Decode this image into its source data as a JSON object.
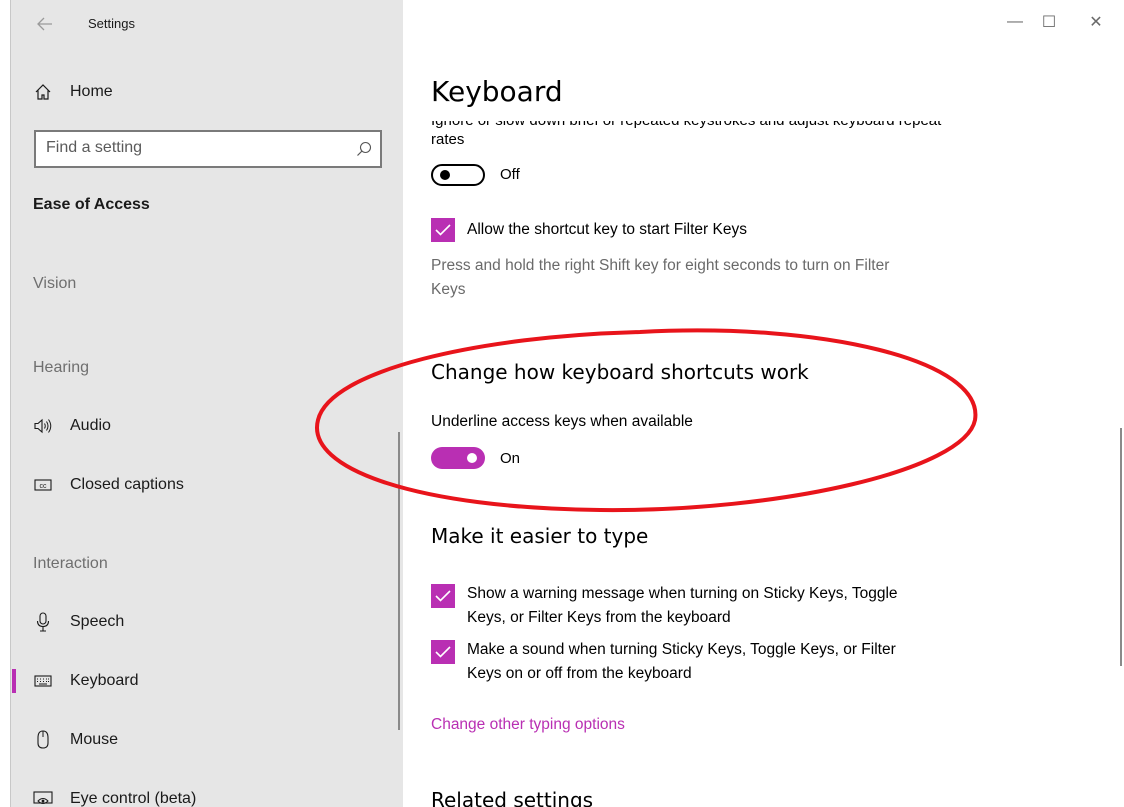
{
  "window": {
    "app_title": "Settings",
    "back_icon": "back-arrow-icon",
    "controls": {
      "minimize": "—",
      "maximize": "☐",
      "close": "✕"
    }
  },
  "sidebar": {
    "home_label": "Home",
    "search_placeholder": "Find a setting",
    "category": "Ease of Access",
    "sections": {
      "vision": "Vision",
      "hearing": "Hearing",
      "interaction": "Interaction"
    },
    "hearing_items": [
      {
        "label": "Audio",
        "icon": "speaker-icon"
      },
      {
        "label": "Closed captions",
        "icon": "cc-icon"
      }
    ],
    "interaction_items": [
      {
        "label": "Speech",
        "icon": "microphone-icon"
      },
      {
        "label": "Keyboard",
        "icon": "keyboard-icon",
        "active": true
      },
      {
        "label": "Mouse",
        "icon": "mouse-icon"
      },
      {
        "label": "Eye control (beta)",
        "icon": "eye-control-icon"
      }
    ]
  },
  "main": {
    "title": "Keyboard",
    "clipped_text": "Ignore or slow down brief or repeated keystrokes and adjust keyboard repeat",
    "rates_text": "rates",
    "filter_keys_toggle": {
      "state": "Off",
      "on": false
    },
    "filter_shortcut_checkbox": {
      "label": "Allow the shortcut key to start Filter Keys",
      "checked": true
    },
    "filter_shortcut_desc_line1": "Press and hold the right Shift key for eight seconds to turn on Filter",
    "filter_shortcut_desc_line2": "Keys",
    "shortcuts_heading": "Change how keyboard shortcuts work",
    "underline_label": "Underline access keys when available",
    "underline_toggle": {
      "state": "On",
      "on": true
    },
    "easier_heading": "Make it easier to type",
    "warning_checkbox": {
      "line1": "Show a warning message when turning on Sticky Keys, Toggle",
      "line2": "Keys, or Filter Keys from the keyboard",
      "checked": true
    },
    "sound_checkbox": {
      "line1": "Make a sound when turning Sticky Keys, Toggle Keys, or Filter",
      "line2": "Keys on or off from the keyboard",
      "checked": true
    },
    "typing_link": "Change other typing options",
    "related_heading": "Related settings"
  },
  "colors": {
    "accent": "#b92fb3",
    "sidebar_bg": "#e6e6e6",
    "annotation": "#e8141b"
  }
}
